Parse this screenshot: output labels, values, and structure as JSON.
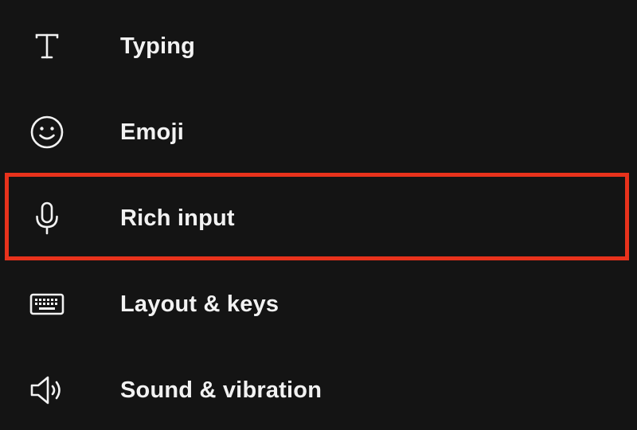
{
  "menu": {
    "items": [
      {
        "label": "Typing",
        "icon": "text-t-icon"
      },
      {
        "label": "Emoji",
        "icon": "smiley-icon"
      },
      {
        "label": "Rich input",
        "icon": "microphone-icon"
      },
      {
        "label": "Layout & keys",
        "icon": "keyboard-icon"
      },
      {
        "label": "Sound & vibration",
        "icon": "speaker-icon"
      }
    ],
    "highlighted_item": "Rich input"
  },
  "colors": {
    "background": "#141414",
    "text": "#f2f2f2",
    "highlight": "#e8321c"
  }
}
